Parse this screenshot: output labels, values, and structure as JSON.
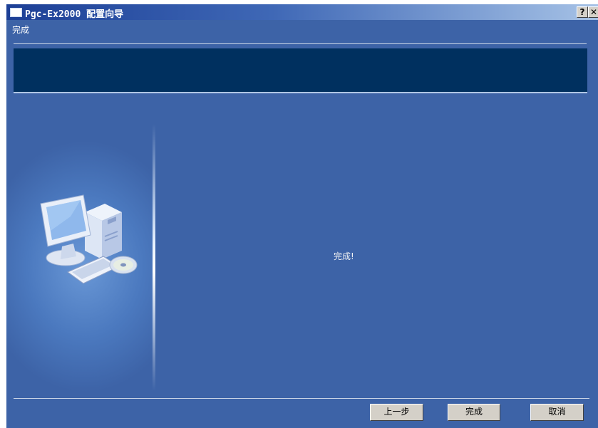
{
  "window": {
    "title": "Pgc-Ex2000 配置向导",
    "help_label": "?",
    "close_label": "✕"
  },
  "page": {
    "heading": "完成",
    "status_message": "完成!"
  },
  "buttons": {
    "back": "上一步",
    "finish": "完成",
    "cancel": "取消"
  },
  "colors": {
    "window_bg": "#3d63a7",
    "banner_bg": "#00305f",
    "button_face": "#d4d0c8"
  },
  "icons": {
    "title": "app-icon",
    "illustration": "computer-illustration-icon"
  }
}
